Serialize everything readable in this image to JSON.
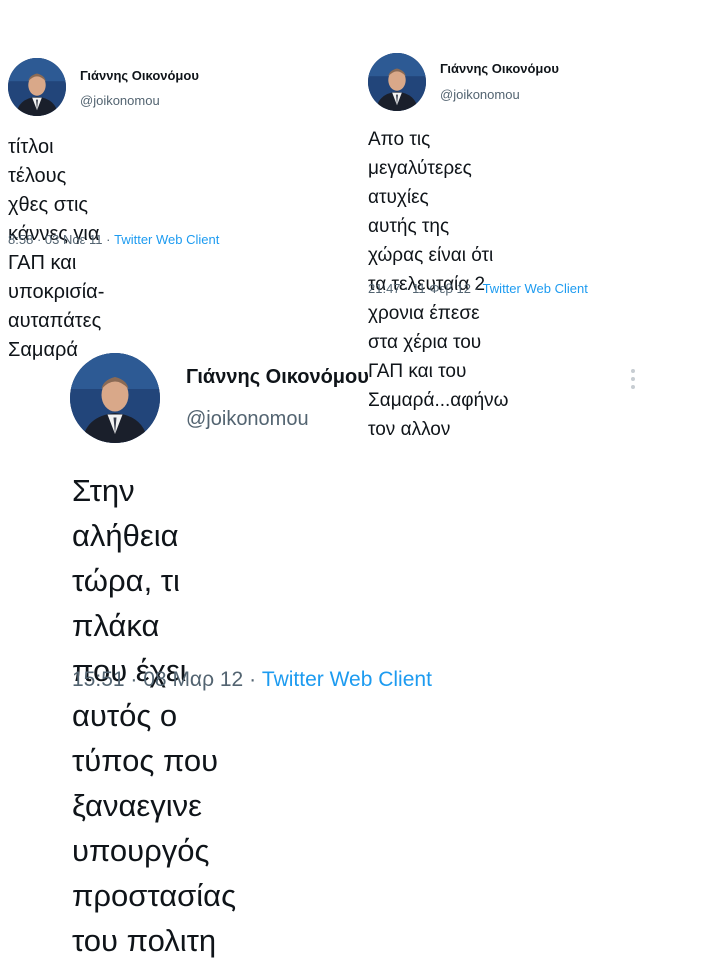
{
  "tweets": [
    {
      "name": "Γιάννης Οικονόμου",
      "handle": "@joikonomou",
      "text": "τίτλοι τέλους χθες στις\nκάννες για ΓΑΠ και υποκρισία-\nαυταπάτες Σαμαρά",
      "time": "8:58",
      "date": "03 Νοε 11",
      "client": "Twitter Web Client"
    },
    {
      "name": "Γιάννης Οικονόμου",
      "handle": "@joikonomou",
      "text": "Απο τις μεγαλύτερες ατυχίες\nαυτής της χώρας είναι ότι\nτα τελευταία 2 χρονια έπεσε\nστα χέρια του ΓΑΠ και του\nΣαμαρά...αφήνω τον αλλον",
      "time": "21:47",
      "date": "11 Φεβ 12",
      "client": "Twitter Web Client"
    },
    {
      "name": "Γιάννης Οικονόμου",
      "handle": "@joikonomou",
      "text": "Στην αλήθεια τώρα, τι πλάκα\nπου έχει αυτός ο τύπος που\nξαναεγινε υπουργός προστασίας\nτου πολιτη",
      "time": "15:51",
      "date": "08 Μαρ 12",
      "client": "Twitter Web Client"
    }
  ],
  "separator": "·",
  "colors": {
    "link": "#1d9bf0",
    "secondary": "#536471",
    "text": "#0f1419"
  }
}
